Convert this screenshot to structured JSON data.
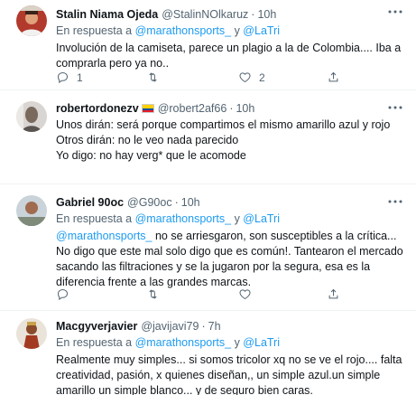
{
  "tweets": [
    {
      "name": "Stalin Niama Ojeda",
      "handle": "@StalinNOlkaruz",
      "dot": "·",
      "time": "10h",
      "reply_prefix": "En respuesta a",
      "reply_mention_1": "@marathonsports_",
      "reply_and": "y",
      "reply_mention_2": "@LaTri",
      "text": "Involución de la camiseta,  parece un plagio a la de Colombia....  Iba a comprarla pero ya no..",
      "replies": "1",
      "retweets": "",
      "likes": "2"
    },
    {
      "name": "robertordonezv",
      "handle": "@robert2af66",
      "dot": "·",
      "time": "10h",
      "text_lines": [
        "Unos dirán: será porque compartimos el mismo amarillo azul y rojo",
        "Otros dirán: no le veo nada parecido",
        "Yo digo: no hay verg* que le acomode"
      ]
    },
    {
      "name": "Gabriel 90oc",
      "handle": "@G90oc",
      "dot": "·",
      "time": "10h",
      "reply_prefix": "En respuesta a",
      "reply_mention_1": "@marathonsports_",
      "reply_and": "y",
      "reply_mention_2": "@LaTri",
      "text_mention": "@marathonsports_",
      "text": " no se arriesgaron, son susceptibles a la crítica... No digo que este mal solo digo que es común!. Tantearon el mercado sacando las filtraciones y se la jugaron por la segura, esa es la diferencia frente a las grandes marcas."
    },
    {
      "name": "Macgyverjavier",
      "handle": "@javijavi79",
      "dot": "·",
      "time": "7h",
      "reply_prefix": "En respuesta a",
      "reply_mention_1": "@marathonsports_",
      "reply_and": "y",
      "reply_mention_2": "@LaTri",
      "text": "Realmente muy simples... si somos tricolor xq no se ve el rojo.... falta creatividad, pasión, x quienes diseñan,, un simple azul.un simple amarillo un simple blanco... y de seguro bien caras."
    }
  ],
  "icons": {
    "reply": "reply-icon",
    "retweet": "retweet-icon",
    "like": "like-icon",
    "share": "share-icon",
    "more": "more-icon"
  },
  "colors": {
    "link": "#1d9bf0",
    "secondary_text": "#536471",
    "primary_text": "#0f1419",
    "border": "#eff3f4"
  }
}
